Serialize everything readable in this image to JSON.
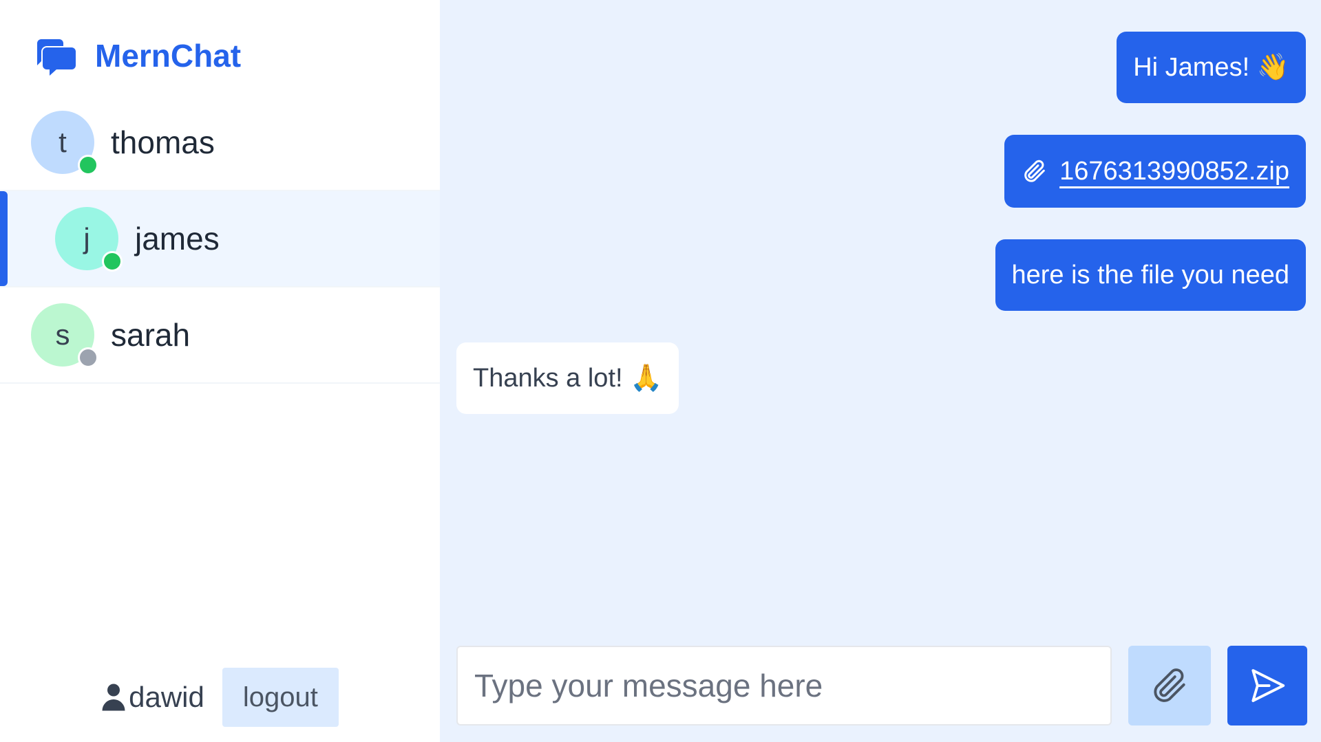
{
  "app": {
    "name": "MernChat",
    "accent_color": "#2563eb"
  },
  "contacts": [
    {
      "initial": "t",
      "name": "thomas",
      "online": true,
      "selected": false,
      "avatar_color": "#bfdbfe"
    },
    {
      "initial": "j",
      "name": "james",
      "online": true,
      "selected": true,
      "avatar_color": "#99f6e4"
    },
    {
      "initial": "s",
      "name": "sarah",
      "online": false,
      "selected": false,
      "avatar_color": "#bbf7d0"
    }
  ],
  "status_colors": {
    "online": "#22c55e",
    "offline": "#9ca3af"
  },
  "footer": {
    "username": "dawid",
    "user_icon": "user-icon",
    "logout_label": "logout"
  },
  "messages": [
    {
      "from": "me",
      "type": "text",
      "text": "Hi James! 👋"
    },
    {
      "from": "me",
      "type": "file",
      "icon": "paperclip-icon",
      "text": "1676313990852.zip"
    },
    {
      "from": "me",
      "type": "text",
      "text": "here is the file you need"
    },
    {
      "from": "them",
      "type": "text",
      "text": "Thanks a lot! 🙏"
    }
  ],
  "composer": {
    "placeholder": "Type your message here",
    "value": "",
    "attach_icon": "paperclip-icon",
    "send_icon": "send-icon"
  }
}
